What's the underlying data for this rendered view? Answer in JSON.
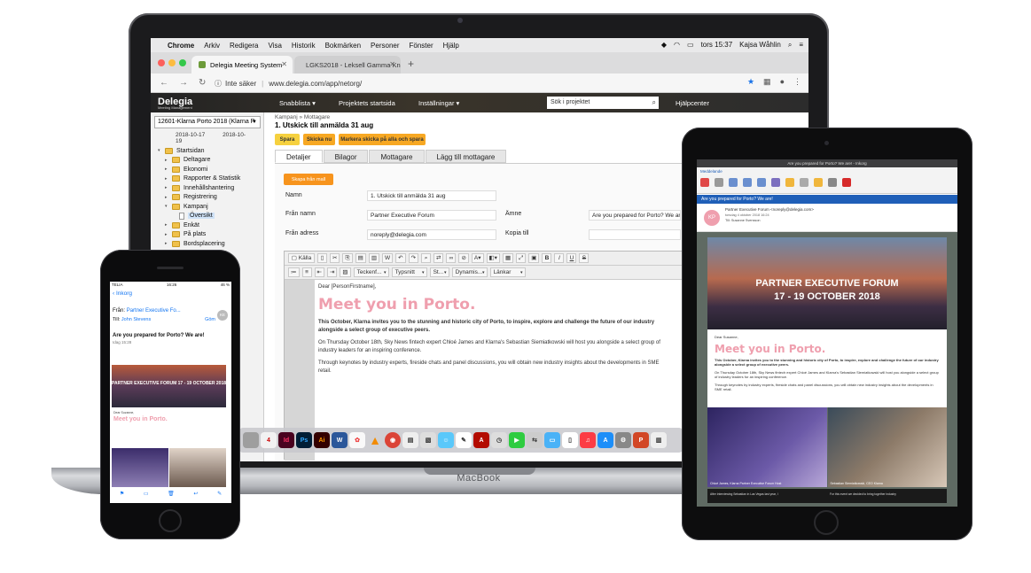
{
  "mac_menubar": {
    "items": [
      "Chrome",
      "Arkiv",
      "Redigera",
      "Visa",
      "Historik",
      "Bokmärken",
      "Personer",
      "Fönster",
      "Hjälp"
    ],
    "clock": "tors 15:37",
    "user": "Kajsa Wåhlin"
  },
  "browser": {
    "tab_active": "Delegia Meeting System",
    "tab_inactive": "LGKS2018 - Leksell Gamma Kn...",
    "security": "Inte säker",
    "url": "www.delegia.com/app/netorg/"
  },
  "app_header": {
    "logo": "Delegia",
    "logo_sub": "Meeting Management",
    "snabblista": "Snabblista ▾",
    "projektets_startsida": "Projektets startsida",
    "installningar": "Inställningar ▾",
    "search_placeholder": "Sök i projektet",
    "help": "Hjälpcenter"
  },
  "left_panel": {
    "project": "12601-Klarna Porto 2018 (Klarna P",
    "date_from": "2018-10-17",
    "date_to": "2018-10-19",
    "tree": [
      "Startsidan",
      "Deltagare",
      "Ekonomi",
      "Rapporter & Statistik",
      "Innehållshantering",
      "Registrering",
      "Kampanj",
      "Översikt",
      "Enkät",
      "På plats",
      "Bordsplacering"
    ]
  },
  "main": {
    "breadcrumb": "Kampanj » Mottagare",
    "title": "1. Utskick till anmälda 31 aug",
    "btn_save": "Spara",
    "btn_send": "Skicka nu",
    "btn_mark": "Markera skicka på alla och spara",
    "tabs": [
      "Detaljer",
      "Bilagor",
      "Mottagare",
      "Lägg till mottagare"
    ],
    "skapa": "Skapa från mall",
    "labels": {
      "namn": "Namn",
      "fran_namn": "Från namn",
      "fran_adress": "Från adress",
      "amne": "Ämne",
      "kopia": "Kopia till"
    },
    "values": {
      "namn": "1. Utskick till anmälda 31 aug",
      "fran_namn": "Partner Executive Forum",
      "fran_adress": "noreply@delegia.com",
      "amne": "Are you prepared for Porto? We are!"
    },
    "toolbar_source": "Källa",
    "dropdowns": [
      "Teckenf...",
      "Typsnitt",
      "St...",
      "Dynamis...",
      "Länkar"
    ]
  },
  "editor": {
    "greeting": "Dear [PersonFirstname],",
    "heading": "Meet you in Porto.",
    "p1": "This October, Klarna invites you to the stunning and historic city of Porto, to inspire, explore and challenge the future of our industry alongside a select group of executive peers.",
    "p2": "On Thursday October 18th, Sky News fintech expert Chloé James and Klarna's Sebastian Siemiatkowski will host you alongside a select group of industry leaders for an inspiring conference.",
    "p3": "Through keynotes by industry experts, fireside chats and panel discussions, you will obtain new industry insights about the developments in SME retail."
  },
  "laptop_label": "MacBook",
  "phone": {
    "carrier": "TELIA",
    "time": "16:26",
    "battery": "46 %",
    "back": "Inkorg",
    "from_label": "Från:",
    "from": "Partner Executive Fo...",
    "to_label": "Till:",
    "to": "John Stevens",
    "hide": "Göm",
    "avatar": "KE",
    "subject": "Are you prepared for Porto? We are!",
    "date": "Idag 15:28",
    "banner": "PARTNER EXECUTIVE FORUM 17 - 19 OCTOBER 2018",
    "greeting": "Dear Suzanne,",
    "heading": "Meet you in Porto."
  },
  "tablet": {
    "window_title": "Are you prepared for Porto? We are! - Inkorg",
    "ribbon_tab": "Meddelande",
    "subject": "Are you prepared for Porto? We are!",
    "avatar": "KP",
    "from": "Partner Executive Forum <noreply@delegia.com>",
    "date": "torsdag 4 oktober 2018 16:24",
    "to_label": "Till:",
    "to": "Susanne Svensson",
    "banner_line1": "PARTNER EXECUTIVE FORUM",
    "banner_line2": "17 - 19 OCTOBER 2018",
    "greeting": "Dear Susanne,",
    "heading": "Meet you in Porto.",
    "p1": "This October, Klarna invites you to the stunning and historic city of Porto, to inspire, explore and challenge the future of our industry alongside a select group of executive peers.",
    "p2": "On Thursday October 18th, Sky News fintech expert Chloé James and Klarna's Sebastian Siemiatkowski will host you alongside a select group of industry leaders for an inspiring conference.",
    "p3": "Through keynotes by industry experts, fireside chats and panel discussions, you will obtain new industry insights about the developments in SME retail.",
    "caption1": "Chloé James, Klarna Partner Executive Forum Host",
    "caption2": "Sebastian Siemiatkowski, CEO Klarna",
    "bottom1": "After interviewing Sebastian in Las Vegas last year, I",
    "bottom2": "For this event we decided to bring together industry"
  }
}
